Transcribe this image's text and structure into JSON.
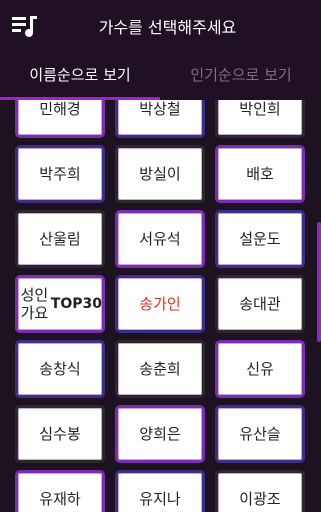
{
  "header": {
    "title": "가수를 선택해주세요",
    "icon": "music-queue-icon"
  },
  "tabs": [
    {
      "label": "이름순으로 보기",
      "active": true
    },
    {
      "label": "인기순으로 보기",
      "active": false
    }
  ],
  "singers": [
    [
      "민해경",
      "박상철",
      "박인희"
    ],
    [
      "박주희",
      "방실이",
      "배호"
    ],
    [
      "산울림",
      "서유석",
      "설운도"
    ],
    [
      "성인가요\nTOP30",
      "송가인",
      "송대관"
    ],
    [
      "송창식",
      "송춘희",
      "신유"
    ],
    [
      "심수봉",
      "양희은",
      "유산슬"
    ],
    [
      "유재하",
      "유지나",
      "이광조"
    ]
  ],
  "highlight": "송가인",
  "colors": {
    "accent": "#a31fd1",
    "highlight_text": "#e0311f",
    "background": "#1c1220"
  }
}
